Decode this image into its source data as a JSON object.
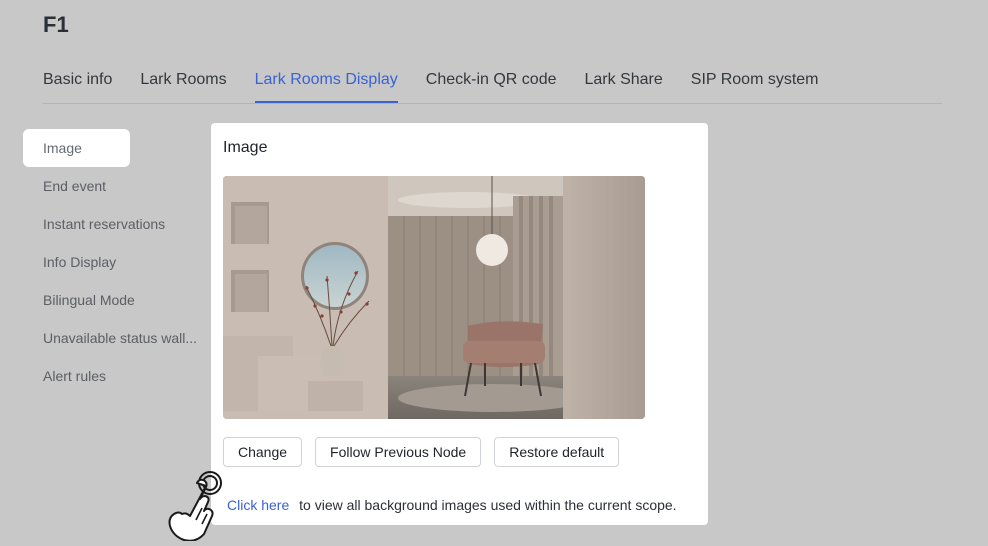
{
  "page": {
    "title": "F1"
  },
  "tabs": [
    {
      "label": "Basic info",
      "active": false
    },
    {
      "label": "Lark Rooms",
      "active": false
    },
    {
      "label": "Lark Rooms Display",
      "active": true
    },
    {
      "label": "Check-in QR code",
      "active": false
    },
    {
      "label": "Lark Share",
      "active": false
    },
    {
      "label": "SIP Room system",
      "active": false
    }
  ],
  "sidebar": {
    "items": [
      {
        "label": "Image",
        "active": true
      },
      {
        "label": "End event",
        "active": false
      },
      {
        "label": "Instant reservations",
        "active": false
      },
      {
        "label": "Info Display",
        "active": false
      },
      {
        "label": "Bilingual Mode",
        "active": false
      },
      {
        "label": "Unavailable status wall...",
        "active": false
      },
      {
        "label": "Alert rules",
        "active": false
      }
    ]
  },
  "card": {
    "title": "Image",
    "preview_icon": "room-background-image",
    "buttons": {
      "change": "Change",
      "follow": "Follow Previous Node",
      "restore": "Restore default"
    },
    "hint": {
      "link": "Click here",
      "text": "to view all background images used within the current scope."
    }
  },
  "cursor_icon": "pointing-hand-click-icon",
  "colors": {
    "accent": "#3a62d3",
    "overlay_bg": "#c8c8c8",
    "card_bg": "#ffffff"
  }
}
